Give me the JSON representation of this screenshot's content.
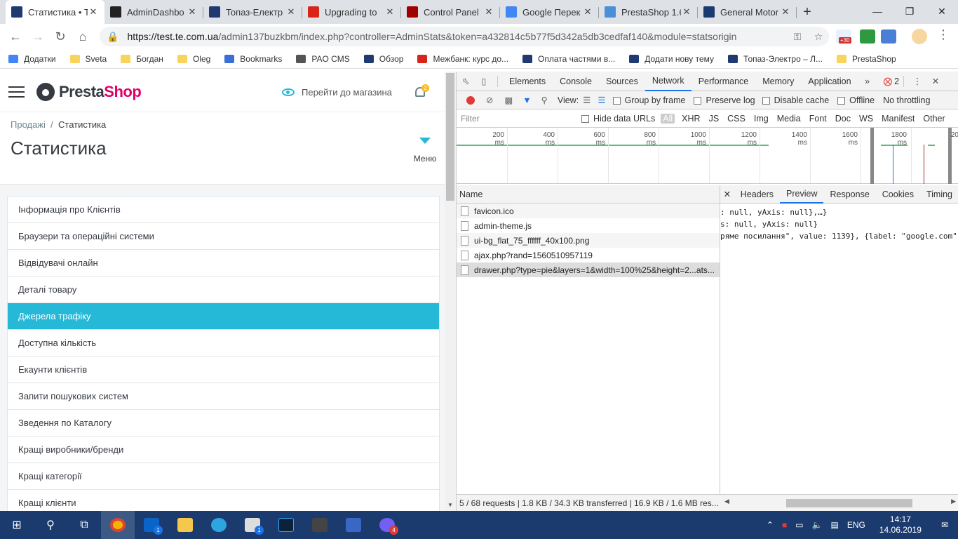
{
  "browser": {
    "tabs": [
      {
        "title": "Статистика • Т",
        "fav_color": "#1e3a70",
        "active": true
      },
      {
        "title": "AdminDashbo",
        "fav_color": "#222222"
      },
      {
        "title": "Топаз-Електр",
        "fav_color": "#1e3a70"
      },
      {
        "title": "Upgrading to",
        "fav_color": "#d9241a"
      },
      {
        "title": "Control Panel",
        "fav_color": "#a00000"
      },
      {
        "title": "Google Перек",
        "fav_color": "#4285f4"
      },
      {
        "title": "PrestaShop 1.6",
        "fav_color": "#4a90d9"
      },
      {
        "title": "General Motor",
        "fav_color": "#1a3b6e"
      }
    ],
    "url_host": "https://test.te.com.ua",
    "url_path": "/admin137buzkbm/index.php?controller=AdminStats&token=a432814c5b77f5d342a5db3cedfaf140&module=statsorigin",
    "ext_badge": "+30",
    "bookmarks": [
      {
        "label": "Додатки",
        "kind": "apps"
      },
      {
        "label": "Sveta",
        "kind": "folder"
      },
      {
        "label": "Богдан",
        "kind": "folder"
      },
      {
        "label": "Oleg",
        "kind": "folder"
      },
      {
        "label": "Bookmarks",
        "kind": "star"
      },
      {
        "label": "PAO CMS",
        "kind": "globe"
      },
      {
        "label": "Обзор",
        "kind": "site"
      },
      {
        "label": "Межбанк: курс до...",
        "kind": "m"
      },
      {
        "label": "Оплата частями в...",
        "kind": "site"
      },
      {
        "label": "Додати нову тему",
        "kind": "site"
      },
      {
        "label": "Топаз-Электро – Л...",
        "kind": "site"
      },
      {
        "label": "PrestaShop",
        "kind": "folder"
      }
    ]
  },
  "admin": {
    "logo_a": "Presta",
    "logo_b": "Shop",
    "go_store": "Перейти до магазина",
    "notif_count": "2",
    "breadcrumb_parent": "Продажі",
    "breadcrumb_sep": "/",
    "breadcrumb_current": "Статистика",
    "page_title": "Статистика",
    "menu_label": "Меню",
    "stats_items": [
      "Інформація про Клієнтів",
      "Браузери та операційні системи",
      "Відвідувачі онлайн",
      "Деталі товару",
      "Джерела трафіку",
      "Доступна кількість",
      "Екаунти клієнтів",
      "Запити пошукових систем",
      "Зведення по Каталогу",
      "Кращі виробники/бренди",
      "Кращі категорії",
      "Кращі клієнти"
    ],
    "active_index": 4
  },
  "devtools": {
    "tabs": [
      "Elements",
      "Console",
      "Sources",
      "Network",
      "Performance",
      "Memory",
      "Application"
    ],
    "selected_tab": "Network",
    "error_count": "2",
    "view_label": "View:",
    "group_by_frame": "Group by frame",
    "preserve_log": "Preserve log",
    "disable_cache": "Disable cache",
    "offline": "Offline",
    "throttling": "No throttling",
    "filter_placeholder": "Filter",
    "hide_data_urls": "Hide data URLs",
    "types": [
      "All",
      "XHR",
      "JS",
      "CSS",
      "Img",
      "Media",
      "Font",
      "Doc",
      "WS",
      "Manifest",
      "Other"
    ],
    "ticks": [
      "200 ms",
      "400 ms",
      "600 ms",
      "800 ms",
      "1000 ms",
      "1200 ms",
      "1400 ms",
      "1600 ms",
      "1800 ms",
      "20"
    ],
    "name_header": "Name",
    "requests": [
      "favicon.ico",
      "admin-theme.js",
      "ui-bg_flat_75_ffffff_40x100.png",
      "ajax.php?rand=1560510957119",
      "drawer.php?type=pie&layers=1&width=100%25&height=2...ats..."
    ],
    "status": "5 / 68 requests  |  1.8 KB / 34.3 KB transferred  |  16.9 KB / 1.6 MB res...",
    "detail_tabs": [
      "Headers",
      "Preview",
      "Response",
      "Cookies",
      "Timing"
    ],
    "detail_selected": "Preview",
    "preview_lines": [
      ": null, yAxis: null},…}",
      "s: null, yAxis: null}",
      "ряме посилання\", value: 1139}, {label: \"google.com\","
    ]
  },
  "taskbar": {
    "lang": "ENG",
    "time": "14:17",
    "date": "14.06.2019",
    "notif": "1",
    "outlook_badge": "1",
    "viber_badge": "4"
  }
}
